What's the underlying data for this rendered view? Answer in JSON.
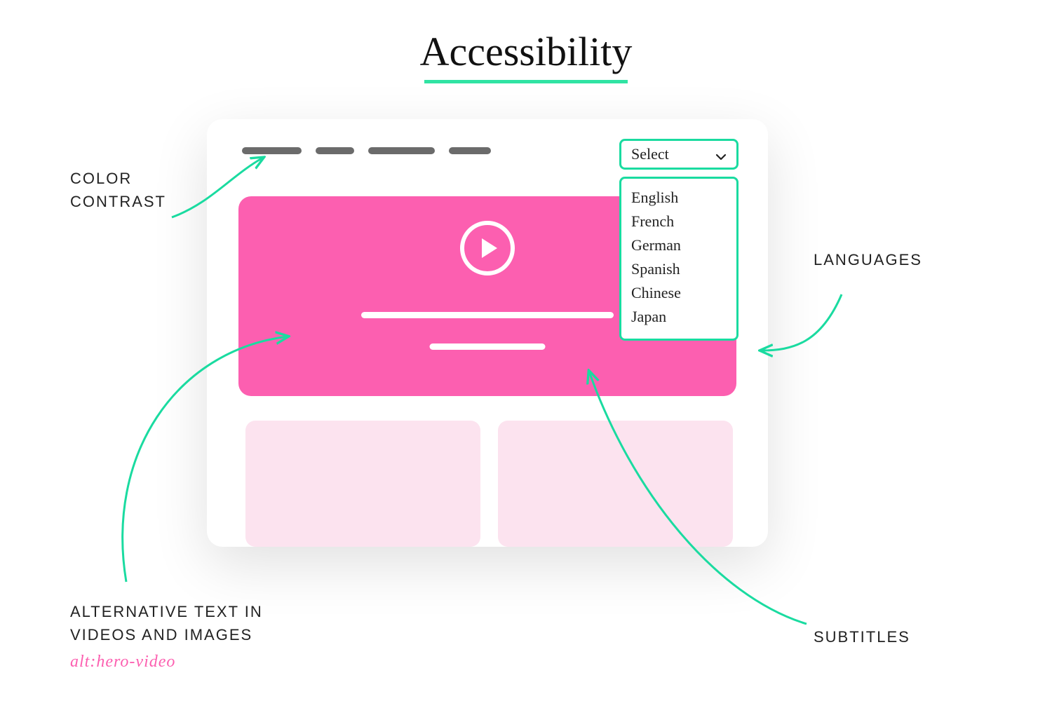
{
  "title": "Accessibility",
  "annotations": {
    "color_contrast": "COLOR CONTRAST",
    "alt_text_line1": "ALTERNATIVE TEXT IN",
    "alt_text_line2": "VIDEOS AND IMAGES",
    "alt_code": "alt:hero-video",
    "languages": "LANGUAGES",
    "subtitles": "SUBTITLES"
  },
  "select": {
    "label": "Select",
    "options": [
      "English",
      "French",
      "German",
      "Spanish",
      "Chinese",
      "Japan"
    ]
  },
  "colors": {
    "accent_green": "#1adba0",
    "hero_pink": "#fc5fb0",
    "placeholder_pink": "#fce3ef",
    "nav_grey": "#6b6b6b"
  }
}
